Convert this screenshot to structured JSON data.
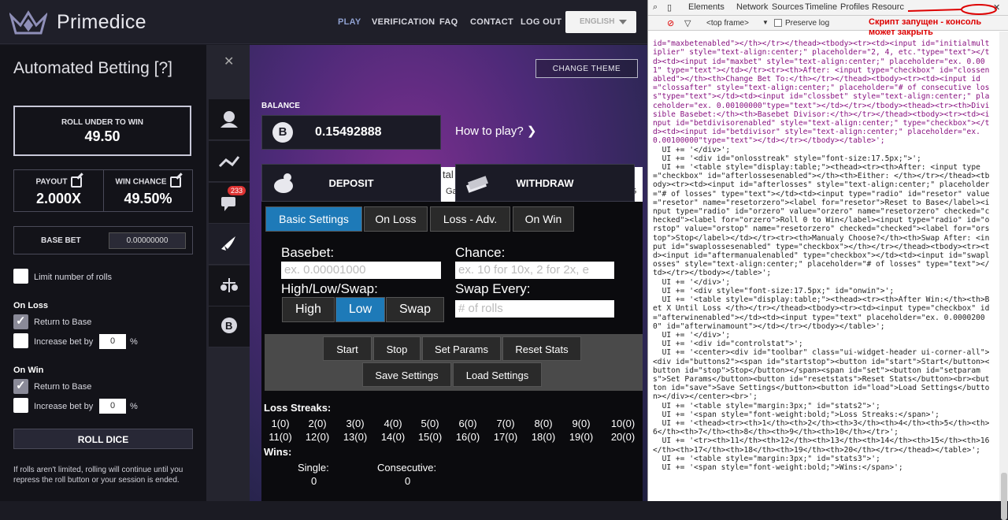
{
  "header": {
    "logo": "Primedice",
    "nav": [
      "PLAY",
      "VERIFICATION",
      "FAQ",
      "CONTACT",
      "LOG OUT"
    ],
    "language": "ENGLISH"
  },
  "left": {
    "title": "Automated Betting [?]",
    "roll_label": "ROLL UNDER TO WIN",
    "roll_value": "49.50",
    "payout_label": "PAYOUT",
    "payout_value": "2.000X",
    "win_label": "WIN CHANCE",
    "win_value": "49.50%",
    "base_label": "BASE BET",
    "base_value": "0.00000000",
    "limit_label": "Limit number of rolls",
    "on_loss": "On Loss",
    "on_win": "On Win",
    "return_base": "Return to Base",
    "increase_by": "Increase bet by",
    "inc_value": "0",
    "pct": "%",
    "roll_dice": "ROLL DICE",
    "note": "If rolls aren't limited, rolling will continue until you repress the roll button or your session is ended."
  },
  "game": {
    "change_theme": "CHANGE THEME",
    "balance_label": "BALANCE",
    "balance": "0.15492888",
    "howto": "How to play?",
    "deposit": "DEPOSIT",
    "withdraw": "WITHDRAW",
    "badge": "233",
    "peek1": "tal W",
    "peek2": "Ga",
    "peek3": "G"
  },
  "bot": {
    "tabs": [
      "Basic Settings",
      "On Loss",
      "Loss - Adv.",
      "On Win"
    ],
    "basebet": "Basebet:",
    "basebet_ph": "ex. 0.00001000",
    "chance": "Chance:",
    "chance_ph": "ex. 10 for 10x, 2 for 2x, e",
    "hls": "High/Low/Swap:",
    "swap_every": "Swap Every:",
    "swap_ph": "# of rolls",
    "high": "High",
    "low": "Low",
    "swap": "Swap",
    "buttons": [
      "Start",
      "Stop",
      "Set Params",
      "Reset Stats",
      "Save Settings",
      "Load Settings"
    ],
    "loss_streaks": "Loss Streaks:",
    "streaks_row1": [
      "1(0)",
      "2(0)",
      "3(0)",
      "4(0)",
      "5(0)",
      "6(0)",
      "7(0)",
      "8(0)",
      "9(0)",
      "10(0)"
    ],
    "streaks_row2": [
      "11(0)",
      "12(0)",
      "13(0)",
      "14(0)",
      "15(0)",
      "16(0)",
      "17(0)",
      "18(0)",
      "19(0)",
      "20(0)"
    ],
    "wins": "Wins:",
    "single": "Single:",
    "consecutive": "Consecutive:",
    "single_val": "0",
    "consec_val": "0"
  },
  "devtools": {
    "tabs": [
      "Elements",
      "Network",
      "Sources",
      "Timeline",
      "Profiles",
      "Resourc"
    ],
    "frame": "<top frame>",
    "preserve": "Preserve log",
    "annotation": "Скрипт запущен - консоль\nможет закрыть"
  }
}
